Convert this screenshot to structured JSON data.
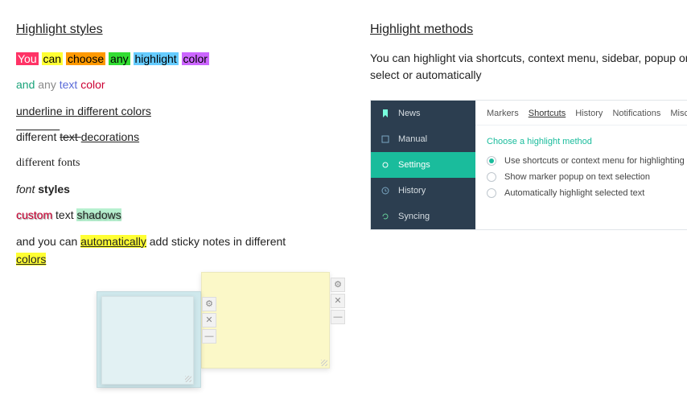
{
  "left": {
    "heading": "Highlight styles",
    "row1": {
      "w1": "You",
      "w2": "can",
      "w3": "choose",
      "w4": "any",
      "w5": "highlight",
      "w6": "color",
      "c1_bg": "#ff3366",
      "c1_fg": "#ffffff",
      "c2_bg": "#ffff33",
      "c2_fg": "#000000",
      "c3_bg": "#ff9900",
      "c3_fg": "#000000",
      "c4_bg": "#33dd33",
      "c4_fg": "#000000",
      "c5_bg": "#66ccff",
      "c5_fg": "#000000",
      "c6_bg": "#cc66ff",
      "c6_fg": "#000000"
    },
    "row2": {
      "w1": "and",
      "w2": "any",
      "w3": "text",
      "w4": "color",
      "c1": "#1aa37a",
      "c2": "#8a8a8a",
      "c3": "#5a6bd8",
      "c4": "#cc0033"
    },
    "row3": {
      "w1": "underline ",
      "w2": "in ",
      "w3": "different ",
      "w4": "colors",
      "c1": "#000000",
      "c2": "#000000",
      "c3": "#000000",
      "c4": "#000000"
    },
    "row4": {
      "w1": "different ",
      "w2": "text ",
      "w3": "decorations"
    },
    "row5": {
      "text": "different fonts",
      "font": "Georgia, 'Times New Roman', serif"
    },
    "row6": {
      "w1": "font ",
      "w2": "styles"
    },
    "row7": {
      "w1": "custom",
      "w2": " text ",
      "w3": "shadows",
      "s1_color": "#cc0033",
      "s3_bg": "#b7f0cf"
    },
    "row8": {
      "pre": "and you can ",
      "auto": "automatically",
      "mid": " add sticky notes in different ",
      "colors": "colors",
      "hl_bg": "#ffff33"
    }
  },
  "right": {
    "heading": "Highlight methods",
    "intro": "You can highlight via shortcuts, context menu, sidebar, popup on select or automatically",
    "sidebar": {
      "items": [
        {
          "label": "News",
          "icon": "bookmark-icon"
        },
        {
          "label": "Manual",
          "icon": "book-icon"
        },
        {
          "label": "Settings",
          "icon": "gear-icon",
          "active": true
        },
        {
          "label": "History",
          "icon": "clock-icon"
        },
        {
          "label": "Syncing",
          "icon": "refresh-icon"
        }
      ]
    },
    "tabs": [
      "Markers",
      "Shortcuts",
      "History",
      "Notifications",
      "Misc."
    ],
    "tab_active": 1,
    "section_head": "Choose a highlight method",
    "options": [
      "Use shortcuts or context menu for highlighting",
      "Show marker popup on text selection",
      "Automatically highlight selected text"
    ],
    "option_selected": 0
  },
  "notes": {
    "buttons": {
      "gear": "⚙",
      "close": "✕",
      "min": "—"
    }
  }
}
